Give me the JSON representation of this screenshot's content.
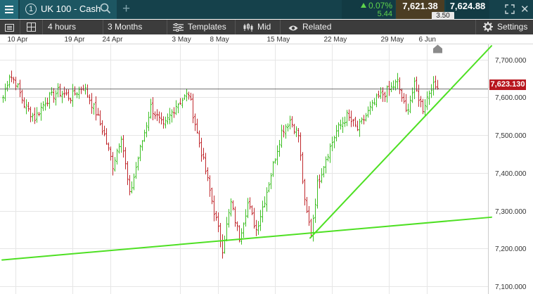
{
  "header": {
    "tab_number": "1",
    "instrument": "UK 100 - Cash",
    "change_percent": "0.07%",
    "change_points": "5.44",
    "sell_price": "7,621.38",
    "buy_price": "7,624.88",
    "spread": "3.50",
    "up_color": "#5ed44c",
    "icons": [
      "menu-icon",
      "search-icon",
      "plus-icon",
      "expand-icon",
      "close-icon"
    ]
  },
  "toolbar": {
    "interval": "4 hours",
    "range": "3 Months",
    "templates": "Templates",
    "price_type": "Mid",
    "related": "Related",
    "settings": "Settings",
    "icons": [
      "list-icon",
      "grid-icon",
      "templates-icon",
      "candles-icon",
      "eye-icon",
      "gear-icon"
    ]
  },
  "date_axis": {
    "labels": [
      "10 Apr",
      "19 Apr",
      "24 Apr",
      "3 May",
      "8 May",
      "15 May",
      "22 May",
      "29 May",
      "6 Jun"
    ]
  },
  "price_axis": {
    "labels": [
      "7,700.000",
      "7,600.000",
      "7,500.000",
      "7,400.000",
      "7,300.000",
      "7,200.000",
      "7,100.000"
    ],
    "last_price": "7,623.130",
    "last_price_color": "#b8171f"
  },
  "chart_data": {
    "type": "ohlc",
    "title": "",
    "xlabel": "",
    "ylabel": "",
    "ylim": [
      7080,
      7740
    ],
    "yticks": [
      7700,
      7600,
      7500,
      7400,
      7300,
      7200,
      7100
    ],
    "grid": true,
    "up_color": "#3cbf23",
    "down_color": "#c0282d",
    "last_price": 7623.13,
    "bars_per_day": 3,
    "date_ticks": [
      {
        "label": "10 Apr",
        "bar": 6
      },
      {
        "label": "19 Apr",
        "bar": 33
      },
      {
        "label": "24 Apr",
        "bar": 51
      },
      {
        "label": "3 May",
        "bar": 84
      },
      {
        "label": "8 May",
        "bar": 102
      },
      {
        "label": "15 May",
        "bar": 129
      },
      {
        "label": "22 May",
        "bar": 156
      },
      {
        "label": "29 May",
        "bar": 183
      },
      {
        "label": "6 Jun",
        "bar": 201
      }
    ],
    "path_points": [
      [
        0,
        7600
      ],
      [
        3,
        7660
      ],
      [
        6,
        7640
      ],
      [
        10,
        7580
      ],
      [
        15,
        7545
      ],
      [
        20,
        7590
      ],
      [
        26,
        7615
      ],
      [
        32,
        7600
      ],
      [
        38,
        7630
      ],
      [
        44,
        7560
      ],
      [
        48,
        7500
      ],
      [
        52,
        7420
      ],
      [
        56,
        7500
      ],
      [
        60,
        7340
      ],
      [
        64,
        7440
      ],
      [
        70,
        7575
      ],
      [
        76,
        7520
      ],
      [
        82,
        7580
      ],
      [
        88,
        7610
      ],
      [
        92,
        7505
      ],
      [
        96,
        7405
      ],
      [
        100,
        7300
      ],
      [
        104,
        7200
      ],
      [
        108,
        7320
      ],
      [
        112,
        7230
      ],
      [
        116,
        7320
      ],
      [
        120,
        7250
      ],
      [
        124,
        7330
      ],
      [
        128,
        7420
      ],
      [
        132,
        7510
      ],
      [
        136,
        7540
      ],
      [
        140,
        7500
      ],
      [
        143,
        7320
      ],
      [
        146,
        7240
      ],
      [
        149,
        7370
      ],
      [
        153,
        7440
      ],
      [
        158,
        7510
      ],
      [
        163,
        7550
      ],
      [
        168,
        7515
      ],
      [
        173,
        7560
      ],
      [
        178,
        7600
      ],
      [
        183,
        7620
      ],
      [
        187,
        7640
      ],
      [
        191,
        7560
      ],
      [
        195,
        7630
      ],
      [
        199,
        7570
      ],
      [
        203,
        7630
      ],
      [
        206,
        7625
      ]
    ],
    "trendlines": [
      {
        "name": "support",
        "color": "#4ee023",
        "from": {
          "bar": 0,
          "price": 7170
        },
        "to": {
          "bar": 232,
          "price": 7283
        }
      },
      {
        "name": "uptrend",
        "color": "#4ee023",
        "from": {
          "bar": 146,
          "price": 7228
        },
        "to": {
          "bar": 232,
          "price": 7736
        }
      }
    ]
  }
}
